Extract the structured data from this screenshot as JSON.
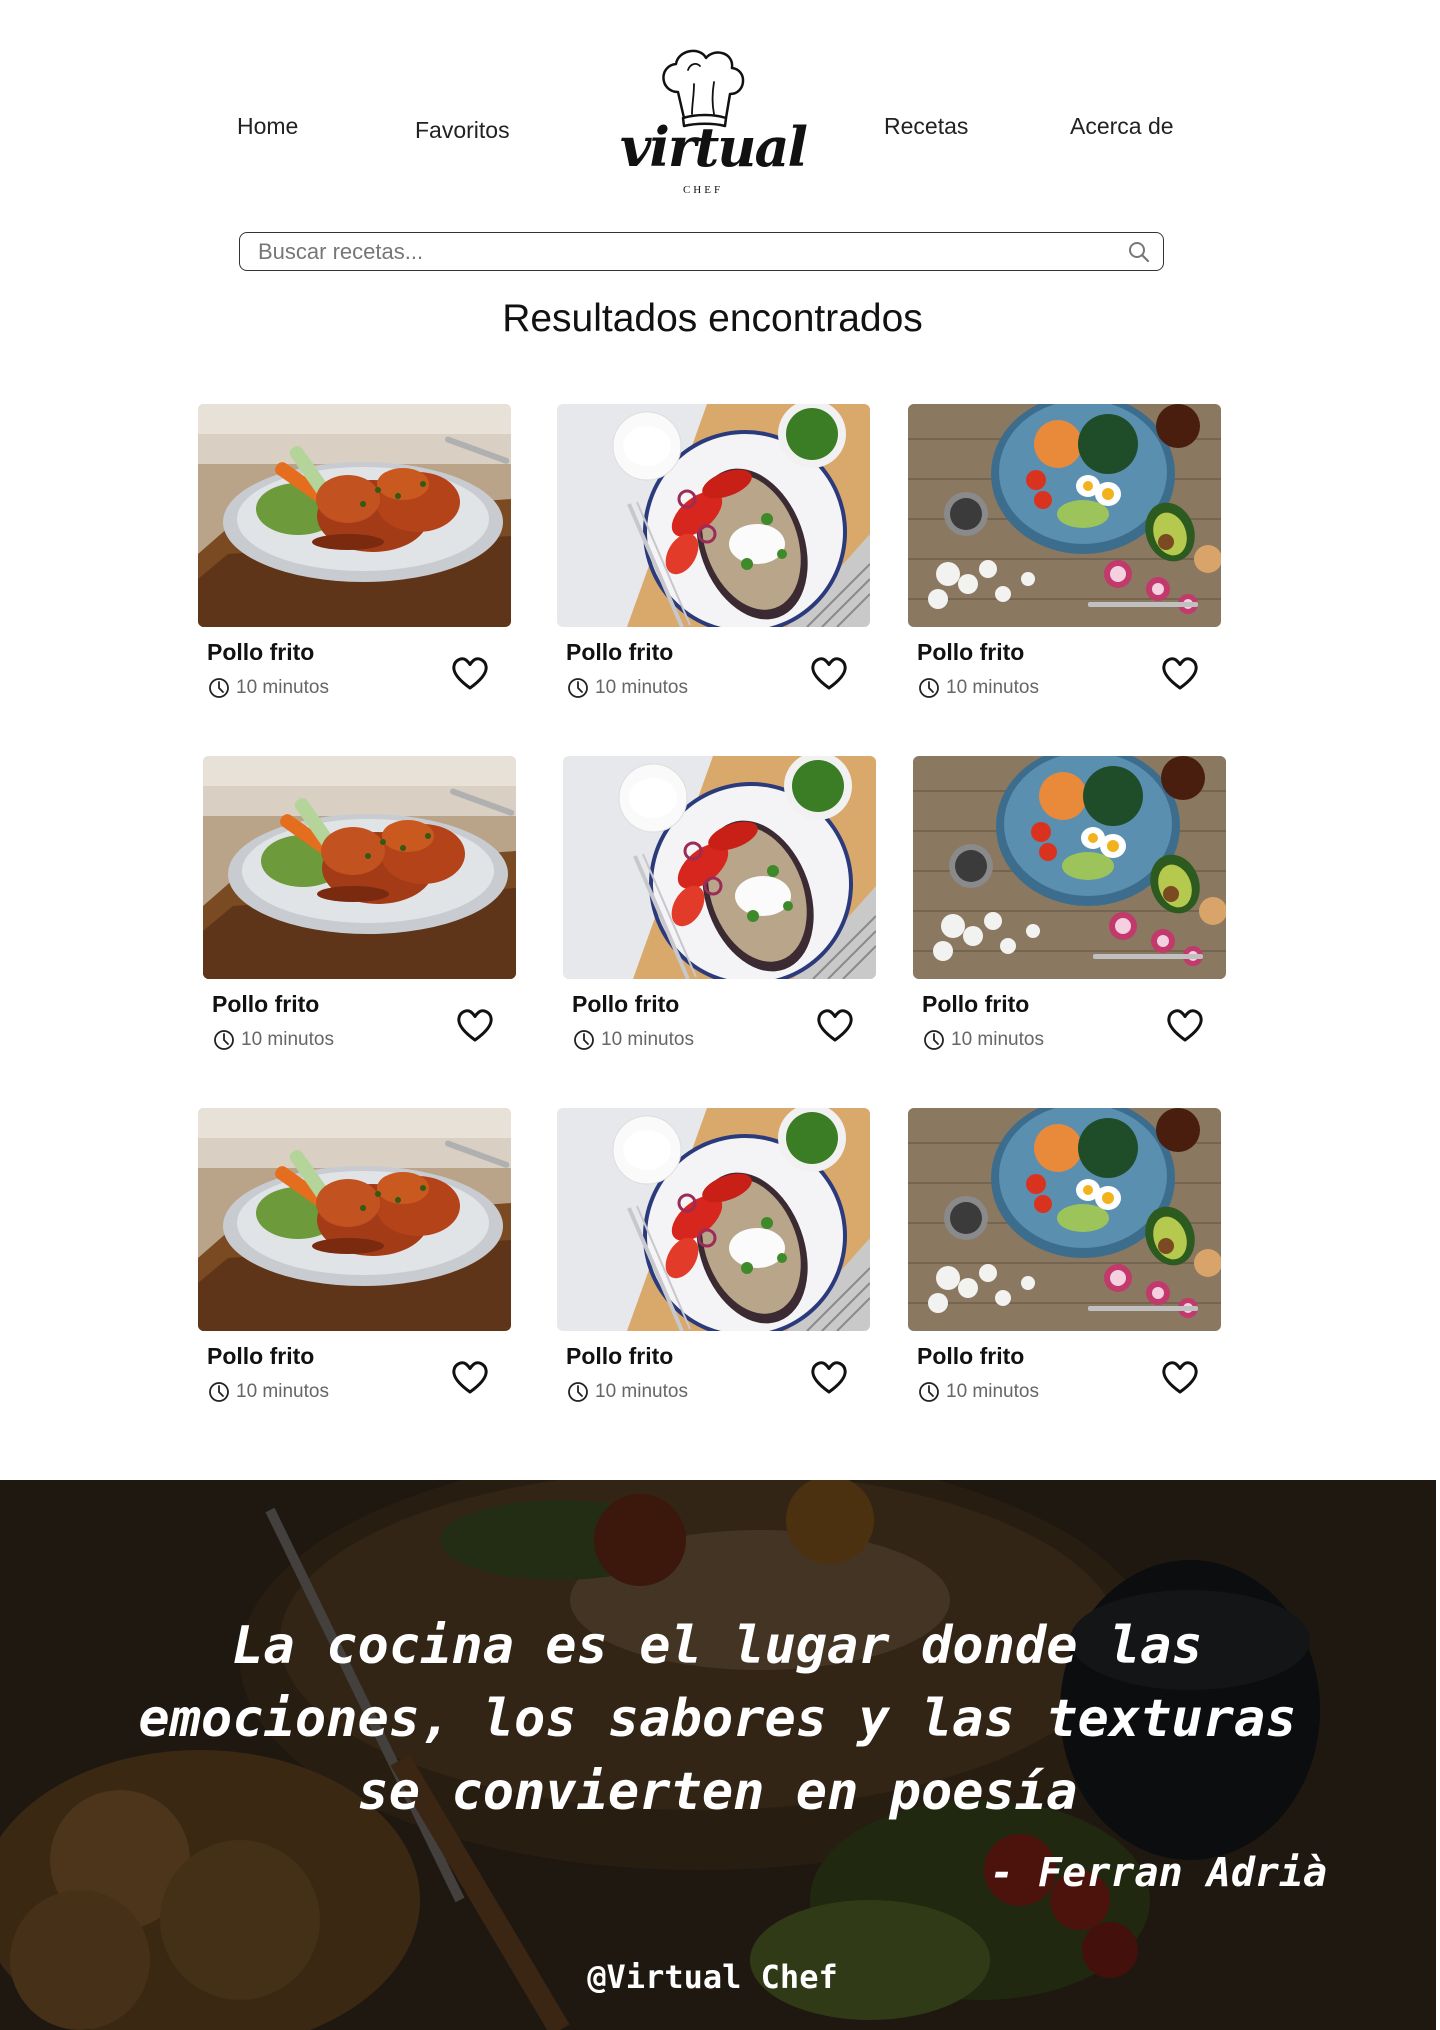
{
  "nav": {
    "home": "Home",
    "favorites": "Favoritos",
    "recipes": "Recetas",
    "about": "Acerca de"
  },
  "logo": {
    "word": "virtual",
    "sub": "CHEF"
  },
  "search": {
    "placeholder": "Buscar recetas..."
  },
  "results": {
    "title": "Resultados encontrados",
    "cards": [
      {
        "title": "Pollo frito",
        "time": "10 minutos",
        "image": "chicken-wings-photo"
      },
      {
        "title": "Pollo frito",
        "time": "10 minutos",
        "image": "eggplant-salad-photo"
      },
      {
        "title": "Pollo frito",
        "time": "10 minutos",
        "image": "veggie-bowl-photo"
      },
      {
        "title": "Pollo frito",
        "time": "10 minutos",
        "image": "chicken-wings-photo"
      },
      {
        "title": "Pollo frito",
        "time": "10 minutos",
        "image": "eggplant-salad-photo"
      },
      {
        "title": "Pollo frito",
        "time": "10 minutos",
        "image": "veggie-bowl-photo"
      },
      {
        "title": "Pollo frito",
        "time": "10 minutos",
        "image": "chicken-wings-photo"
      },
      {
        "title": "Pollo frito",
        "time": "10 minutos",
        "image": "eggplant-salad-photo"
      },
      {
        "title": "Pollo frito",
        "time": "10 minutos",
        "image": "veggie-bowl-photo"
      }
    ]
  },
  "footer": {
    "quote_line1": "La cocina es el lugar donde las",
    "quote_line2": "emociones, los sabores y las texturas",
    "quote_line3": "se convierten en poesía",
    "author": "- Ferran Adrià",
    "handle": "@Virtual Chef"
  },
  "icons": {
    "search": "search-icon",
    "clock": "clock-icon",
    "favorite": "heart-icon",
    "logo": "chef-hat-icon"
  }
}
